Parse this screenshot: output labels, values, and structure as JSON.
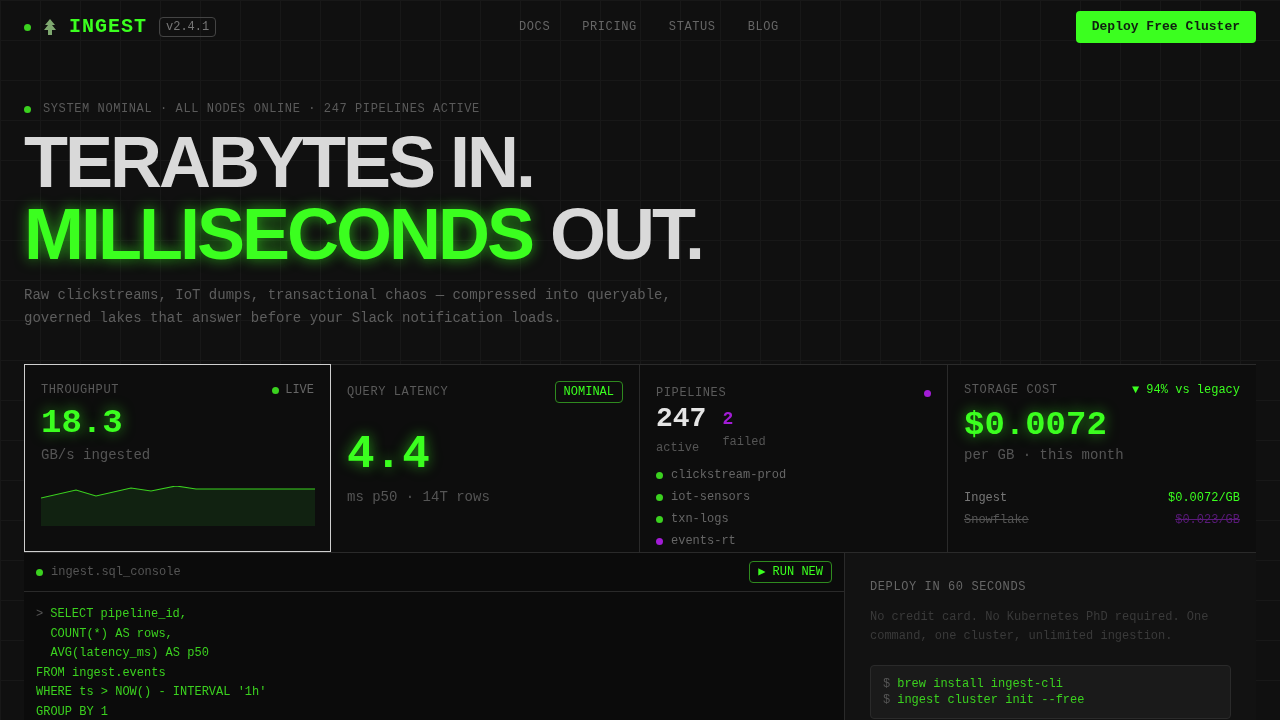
{
  "nav": {
    "brand": "INGEST",
    "version": "v2.4.1",
    "links": [
      "DOCS",
      "PRICING",
      "STATUS",
      "BLOG"
    ],
    "cta": "Deploy Free Cluster"
  },
  "hero": {
    "status": "SYSTEM NOMINAL · ALL NODES ONLINE · 247 PIPELINES ACTIVE",
    "line1": "TERABYTES IN.",
    "line2_accent": "MILLISECONDS",
    "line2_rest": "OUT.",
    "subtitle": "Raw clickstreams, IoT dumps, transactional chaos — compressed into queryable, governed lakes that answer before your Slack notification loads."
  },
  "throughput": {
    "label": "THROUGHPUT",
    "live": "LIVE",
    "value": "18.3",
    "unit": "GB/s ingested",
    "selected": true
  },
  "latency": {
    "label": "QUERY LATENCY",
    "badge": "NOMINAL",
    "value": "4.4",
    "unit": "ms p50 · 14T rows"
  },
  "pipelines": {
    "label": "PIPELINES",
    "alert": {
      "color": "#a21cd6"
    },
    "active": "247",
    "active_label": "active",
    "failed": "2",
    "failed_label": "failed",
    "items": [
      {
        "name": "clickstream-prod",
        "color": "#3bd11f"
      },
      {
        "name": "iot-sensors",
        "color": "#3bd11f"
      },
      {
        "name": "txn-logs",
        "color": "#3bd11f"
      },
      {
        "name": "events-rt",
        "color": "#a21cd6"
      }
    ]
  },
  "storage": {
    "label": "STORAGE COST",
    "delta": "▼ 94% vs legacy",
    "value": "$0.0072",
    "unit": "per GB · this month",
    "rows": [
      {
        "name": "Ingest",
        "price": "$0.0072/GB",
        "struck": false
      },
      {
        "name": "Snowflake",
        "price": "$0.023/GB",
        "struck": true
      }
    ]
  },
  "console": {
    "title": "ingest.sql_console",
    "run": "▶ RUN NEW",
    "prompt": ">",
    "lines": [
      "SELECT pipeline_id,",
      "  COUNT(*) AS rows,",
      "  AVG(latency_ms) AS p50",
      "FROM ingest.events",
      "WHERE ts > NOW() - INTERVAL '1h'",
      "GROUP BY 1"
    ]
  },
  "deploy": {
    "title": "DEPLOY IN 60 SECONDS",
    "text": "No credit card. No Kubernetes PhD required. One command, one cluster, unlimited ingestion.",
    "prompt": "$",
    "commands": [
      "brew install ingest-cli",
      "ingest cluster init --free"
    ]
  }
}
